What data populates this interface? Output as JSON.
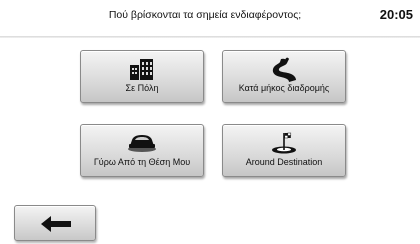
{
  "header": {
    "title": "Πού βρίσκονται τα σημεία ενδιαφέροντος;",
    "clock": "20:05"
  },
  "options": [
    {
      "label": "Σε Πόλη",
      "icon": "city-buildings-icon"
    },
    {
      "label": "Κατά μήκος διαδρομής",
      "icon": "along-route-icon"
    },
    {
      "label": "Γύρω Από τη Θέση Μου",
      "icon": "car-position-icon"
    },
    {
      "label": "Around Destination",
      "icon": "destination-flag-icon"
    }
  ],
  "footer": {
    "back_icon": "back-arrow-icon"
  }
}
